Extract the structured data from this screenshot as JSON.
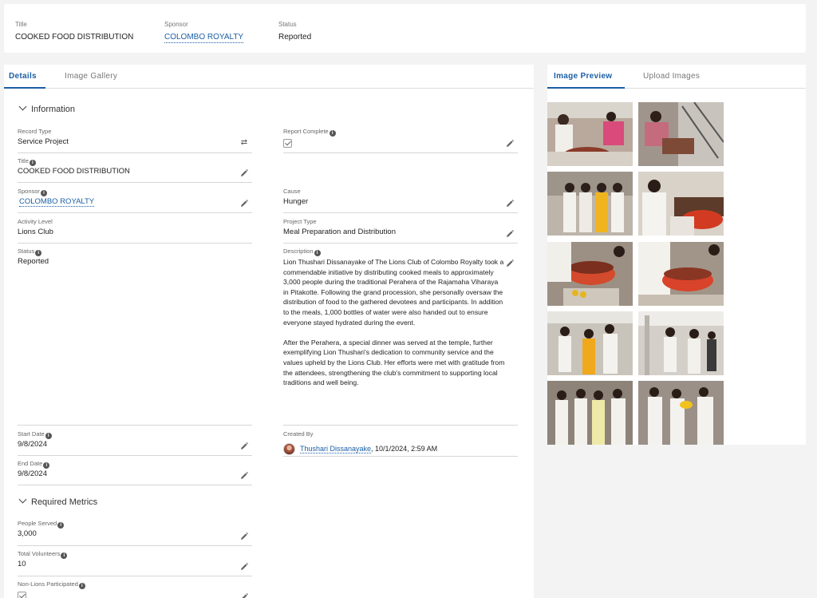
{
  "header": {
    "title_label": "Title",
    "title_value": "COOKED FOOD DISTRIBUTION",
    "sponsor_label": "Sponsor",
    "sponsor_value": "COLOMBO ROYALTY",
    "status_label": "Status",
    "status_value": "Reported"
  },
  "tabs": {
    "details": "Details",
    "gallery": "Image Gallery"
  },
  "sections": {
    "information": "Information",
    "metrics": "Required Metrics"
  },
  "fields": {
    "record_type": {
      "label": "Record Type",
      "value": "Service Project"
    },
    "report_complete": {
      "label": "Report Complete",
      "checked": true
    },
    "title": {
      "label": "Title",
      "value": "COOKED FOOD DISTRIBUTION"
    },
    "sponsor": {
      "label": "Sponsor",
      "value": "COLOMBO ROYALTY"
    },
    "cause": {
      "label": "Cause",
      "value": "Hunger"
    },
    "activity_level": {
      "label": "Activity Level",
      "value": "Lions Club"
    },
    "project_type": {
      "label": "Project Type",
      "value": "Meal Preparation and Distribution"
    },
    "status": {
      "label": "Status",
      "value": "Reported"
    },
    "description": {
      "label": "Description",
      "paragraph1": "Lion Thushari Dissanayake of The Lions Club of Colombo Royalty took a commendable initiative by distributing cooked meals to approximately 3,000 people during the traditional Perahera of the Rajamaha Viharaya in Pitakotte. Following the grand procession, she personally oversaw the distribution of food to the gathered devotees and participants. In addition to the meals, 1,000 bottles of water were also handed out to ensure everyone stayed hydrated during the event.",
      "paragraph2": "After the Perahera, a special dinner was served at the temple, further exemplifying Lion Thushari's dedication to community service and the values upheld by the Lions Club. Her efforts were met with gratitude from the attendees, strengthening the club's commitment to supporting local traditions and well being."
    },
    "start_date": {
      "label": "Start Date",
      "value": "9/8/2024"
    },
    "created_by": {
      "label": "Created By",
      "name": "Thushari Dissanayake",
      "timestamp": ", 10/1/2024, 2:59 AM"
    },
    "end_date": {
      "label": "End Date",
      "value": "9/8/2024"
    },
    "people_served": {
      "label": "People Served",
      "value": "3,000"
    },
    "total_volunteers": {
      "label": "Total Volunteers",
      "value": "10"
    },
    "non_lions": {
      "label": "Non-Lions Participated",
      "checked": true
    }
  },
  "right_panel": {
    "tab_preview": "Image Preview",
    "tab_upload": "Upload Images"
  },
  "icons": {
    "info": "info-icon",
    "edit": "pencil-icon",
    "swap": "swap-icon",
    "chevron": "chevron-down-icon",
    "check": "checkbox-checked-icon"
  },
  "colors": {
    "link": "#1b5fa6",
    "background": "#f3f3f3"
  }
}
